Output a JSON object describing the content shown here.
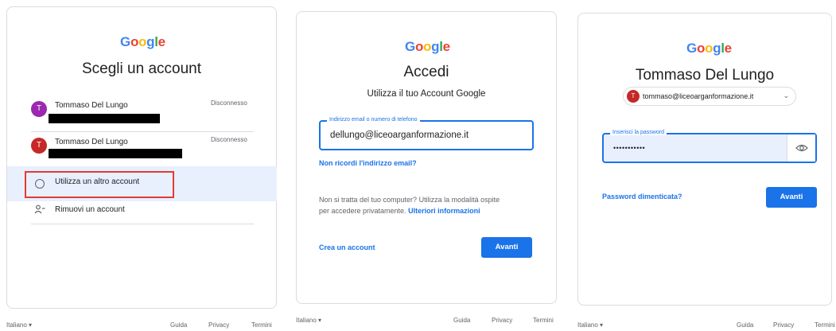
{
  "chooser": {
    "logo": "Google",
    "title": "Scegli un account",
    "accounts": [
      {
        "initial": "T",
        "name": "Tommaso Del Lungo",
        "action": "Disconnesso",
        "color": "#9c27b0"
      },
      {
        "initial": "T",
        "name": "Tommaso Del Lungo",
        "action": "Disconnesso",
        "color": "#c62828"
      }
    ],
    "use_other": "Utilizza un altro account",
    "remove": "Rimuovi un account",
    "footer": {
      "language": "Italiano",
      "help": "Guida",
      "privacy": "Privacy",
      "terms": "Termini"
    }
  },
  "signin": {
    "logo": "Google",
    "title": "Accedi",
    "subtitle": "Utilizza il tuo Account Google",
    "field_label": "Indirizzo email o numero di telefono",
    "field_value": "dellungo@liceoarganformazione.it",
    "forgot_email": "Non ricordi l'indirizzo email?",
    "guest_text_1": "Non si tratta del tuo computer? Utilizza la modalità ospite",
    "guest_text_2": "per accedere privatamente.",
    "learn_more": "Ulteriori informazioni",
    "create_account": "Crea un account",
    "next": "Avanti",
    "footer": {
      "language": "Italiano",
      "help": "Guida",
      "privacy": "Privacy",
      "terms": "Termini"
    }
  },
  "password": {
    "logo": "Google",
    "title": "Tommaso Del Lungo",
    "account_initial": "T",
    "account_email": "tommaso@liceoarganformazione.it",
    "avatar_color": "#c62828",
    "field_label": "Inserisci la password",
    "field_value": "•••••••••••",
    "forgot_password": "Password dimenticata?",
    "next": "Avanti",
    "footer": {
      "language": "Italiano",
      "help": "Guida",
      "privacy": "Privacy",
      "terms": "Termini"
    }
  },
  "colors": {
    "accent": "#1a73e8",
    "highlight_border": "#e53935"
  }
}
